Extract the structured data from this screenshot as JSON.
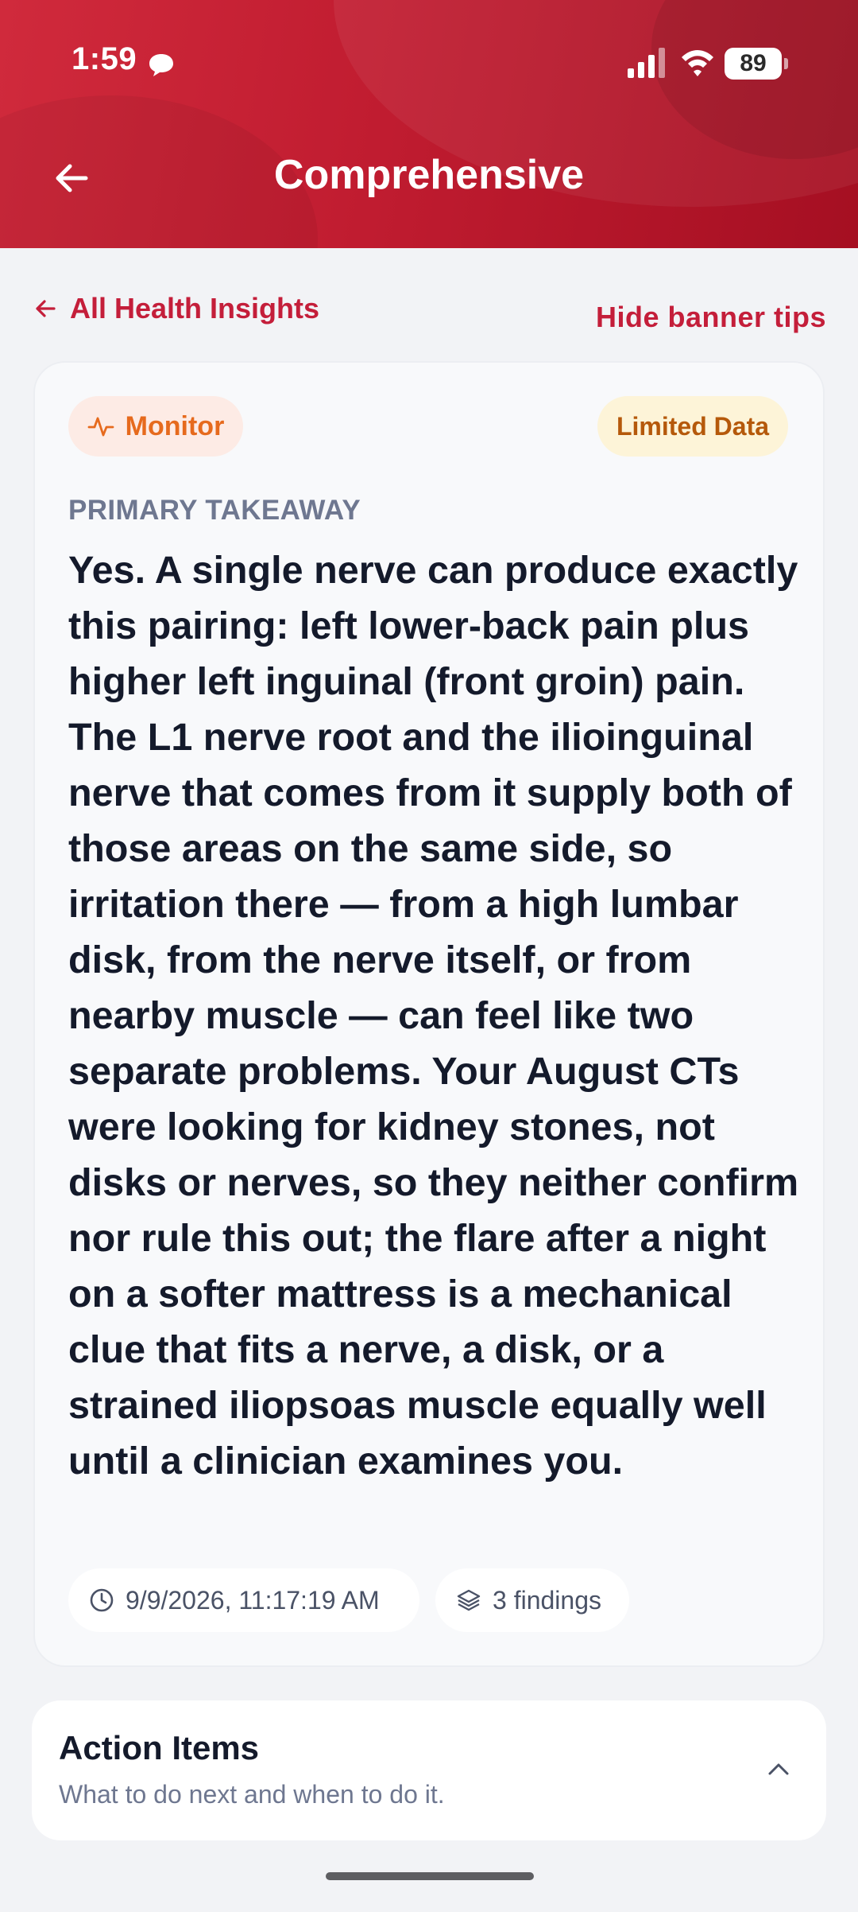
{
  "status_bar": {
    "time": "1:59",
    "battery_level": "89",
    "signal_bars": 4,
    "wifi": true
  },
  "header": {
    "title": "Comprehensive",
    "back_icon": "arrow-left-icon",
    "background_color": "#c41e3a"
  },
  "nav": {
    "all_insights_label": "All Health Insights",
    "hide_tips_label": "Hide banner tips"
  },
  "takeaway_card": {
    "status_badge": "Monitor",
    "status_badge_color": "#e66a1d",
    "data_badge": "Limited Data",
    "data_badge_color": "#b5590b",
    "eyebrow": "PRIMARY TAKEAWAY",
    "body": "Yes. A single nerve can produce exactly this pairing: left lower-back pain plus higher left inguinal (front groin) pain. The L1 nerve root and the ilioinguinal nerve that comes from it supply both of those areas on the same side, so irritation there — from a high lumbar disk, from the nerve itself, or from nearby muscle — can feel like two separate problems. Your August CTs were looking for kidney stones, not disks or nerves, so they neither confirm nor rule this out; the flare after a night on a softer mattress is a mechanical clue that fits a nerve, a disk, or a strained iliopsoas muscle equally well until a clinician examines you.",
    "timestamp": "9/9/2026, 11:17:19 AM",
    "findings": "3 findings"
  },
  "action_items": {
    "title": "Action Items",
    "subtitle": "What to do next and when to do it."
  },
  "colors": {
    "accent": "#c41e3a",
    "page_background": "#f2f3f6",
    "text_primary": "#141a2b",
    "text_muted": "#6e7790"
  }
}
